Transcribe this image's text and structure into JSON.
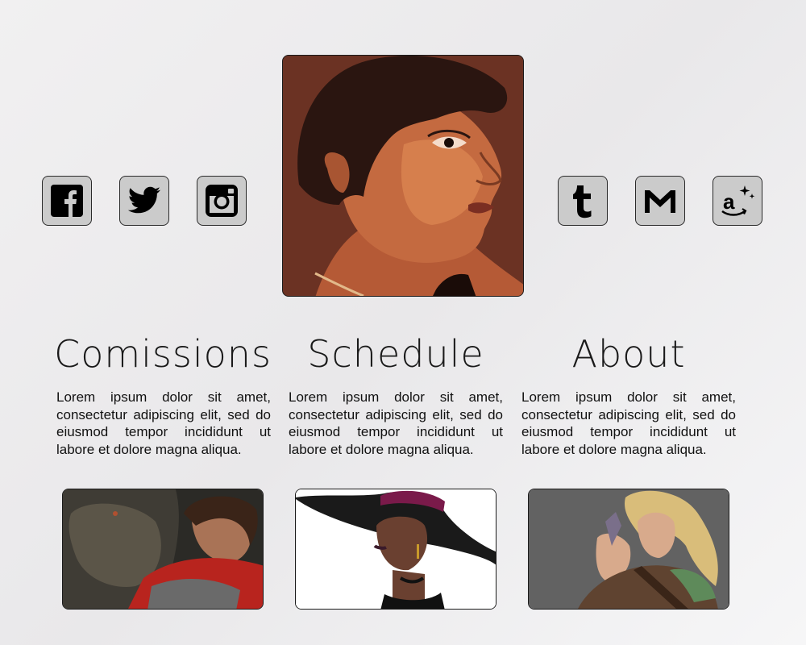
{
  "social_left": [
    {
      "name": "facebook-icon",
      "glyph": "f"
    },
    {
      "name": "twitter-icon",
      "glyph": "bird"
    },
    {
      "name": "instagram-icon",
      "glyph": "camera"
    }
  ],
  "social_right": [
    {
      "name": "tumblr-icon",
      "glyph": "t"
    },
    {
      "name": "gmail-icon",
      "glyph": "M"
    },
    {
      "name": "amazon-icon",
      "glyph": "a"
    }
  ],
  "sections": {
    "commissions": {
      "title": "Comissions",
      "text": "Lorem ipsum dolor sit amet, consectetur adipiscing elit, sed do eiusmod tempor incididunt ut labore et dolore magna aliqua."
    },
    "schedule": {
      "title": "Schedule",
      "text": "Lorem ipsum dolor sit amet, consectetur adipiscing elit, sed do eiusmod tempor incididunt ut labore et dolore magna aliqua."
    },
    "about": {
      "title": "About",
      "text": "Lorem ipsum dolor sit amet, consectetur adipiscing elit, sed do eiusmod tempor incididunt ut labore et dolore magna aliqua."
    }
  },
  "colors": {
    "icon_bg": "#cbcbcb",
    "border": "#1a1a1a",
    "text": "#111111"
  }
}
